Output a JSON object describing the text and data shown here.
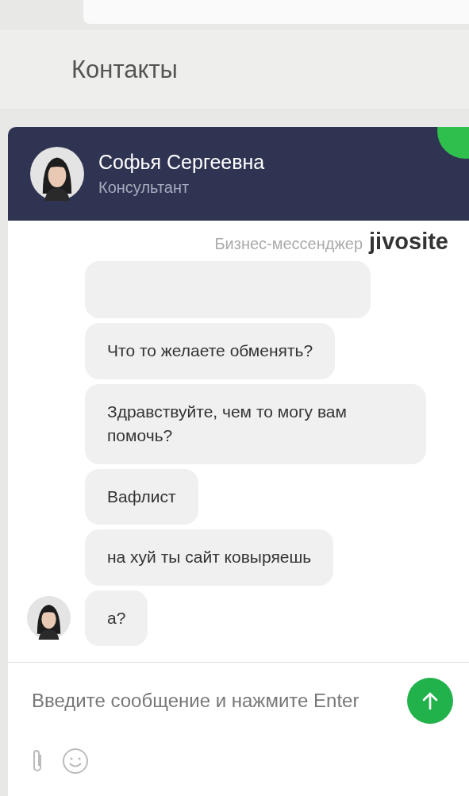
{
  "page": {
    "heading": "Контакты"
  },
  "chat": {
    "agent": {
      "name": "Софья Сергеевна",
      "role": "Консультант"
    },
    "branding": {
      "caption": "Бизнес-мессенджер",
      "logo": "jivosite"
    },
    "messages": [
      {
        "show_avatar": false
      },
      {
        "text": "Что то желаете обменять?",
        "show_avatar": false
      },
      {
        "text": "Здравствуйте, чем то могу вам помочь?",
        "show_avatar": false
      },
      {
        "text": "Вафлист",
        "show_avatar": false
      },
      {
        "text": "на хуй ты сайт ковыряешь",
        "show_avatar": false
      },
      {
        "text": "а?",
        "show_avatar": true
      }
    ],
    "composer": {
      "placeholder": "Введите сообщение и нажмите Enter"
    }
  }
}
